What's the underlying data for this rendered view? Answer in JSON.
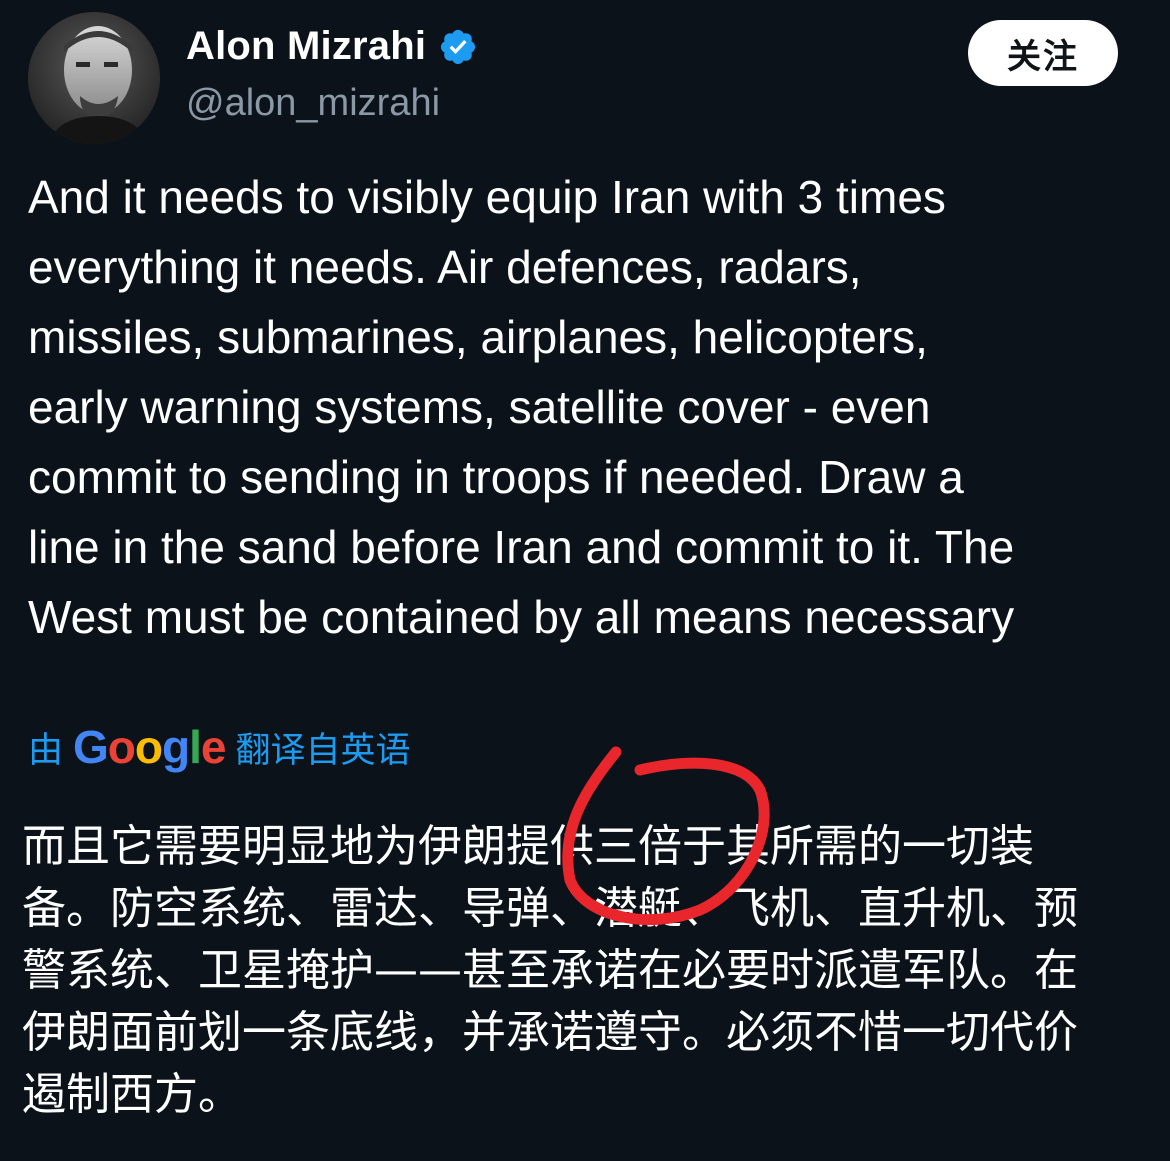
{
  "author": {
    "display_name": "Alon Mizrahi",
    "handle": "@alon_mizrahi",
    "verified": true
  },
  "follow_button": {
    "label": "关注"
  },
  "tweet": {
    "text": "And it needs to visibly equip Iran with 3 times\neverything it needs. Air defences, radars,\nmissiles, submarines, airplanes, helicopters,\nearly warning systems, satellite cover -  even\ncommit to sending in troops if needed. Draw a\nline in the sand before Iran and commit to it. The\nWest must be contained by all means necessary"
  },
  "translation": {
    "by_label": "由",
    "google_letters": [
      {
        "ch": "G",
        "color": "#4285F4"
      },
      {
        "ch": "o",
        "color": "#EA4335"
      },
      {
        "ch": "o",
        "color": "#FBBC05"
      },
      {
        "ch": "g",
        "color": "#4285F4"
      },
      {
        "ch": "l",
        "color": "#34A853"
      },
      {
        "ch": "e",
        "color": "#EA4335"
      }
    ],
    "translated_label": "翻译自英语",
    "text": "而且它需要明显地为伊朗提供三倍于其所需的一切装\n备。防空系统、雷达、导弹、潜艇、飞机、直升机、预\n警系统、卫星掩护——甚至承诺在必要时派遣军队。在\n伊朗面前划一条底线，并承诺遵守。必须不惜一切代价\n遏制西方。"
  },
  "colors": {
    "background": "#0b1219",
    "accent": "#1d9bf0",
    "annotation_red": "#e8262c"
  },
  "icons": [
    "verified-badge-icon",
    "avatar"
  ]
}
